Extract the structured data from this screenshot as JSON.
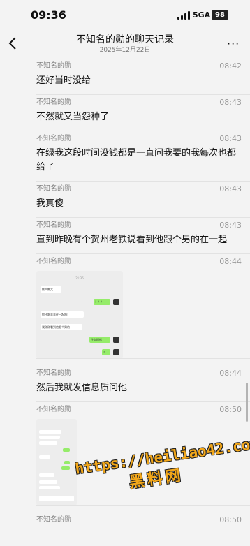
{
  "status": {
    "time": "09:36",
    "network": "5GA",
    "battery": "98"
  },
  "nav": {
    "title": "不知名的勋的聊天记录",
    "subtitle": "2025年12月22日",
    "more": "···"
  },
  "messages": [
    {
      "sender": "不知名的勋",
      "time": "08:42",
      "text": "还好当时没给"
    },
    {
      "sender": "不知名的勋",
      "time": "08:43",
      "text": "不然就又当怨种了"
    },
    {
      "sender": "不知名的勋",
      "time": "08:43",
      "text": "在绿我这段时间没钱都是一直问我要的我每次也都给了"
    },
    {
      "sender": "不知名的勋",
      "time": "08:43",
      "text": "我真傻"
    },
    {
      "sender": "不知名的勋",
      "time": "08:43",
      "text": "直到昨晚有个贺州老铁说看到他跟个男的在一起"
    },
    {
      "sender": "不知名的勋",
      "time": "08:44",
      "image": true,
      "shot": {
        "time": "21:36",
        "m1": "熊大熊大",
        "m2": "？？？",
        "m3": "你还跟菲菲在一起吗？",
        "m4": "我刚刚看到他跟个男的",
        "m5": "什么时候",
        "m6": "？"
      }
    },
    {
      "sender": "不知名的勋",
      "time": "08:44",
      "text": "然后我就发信息质问他"
    },
    {
      "sender": "不知名的勋",
      "time": "08:50",
      "image": true
    },
    {
      "sender": "不知名的勋",
      "time": "08:50"
    }
  ],
  "watermark": {
    "url": "https://heiliao42.com",
    "name": "黑料网"
  }
}
